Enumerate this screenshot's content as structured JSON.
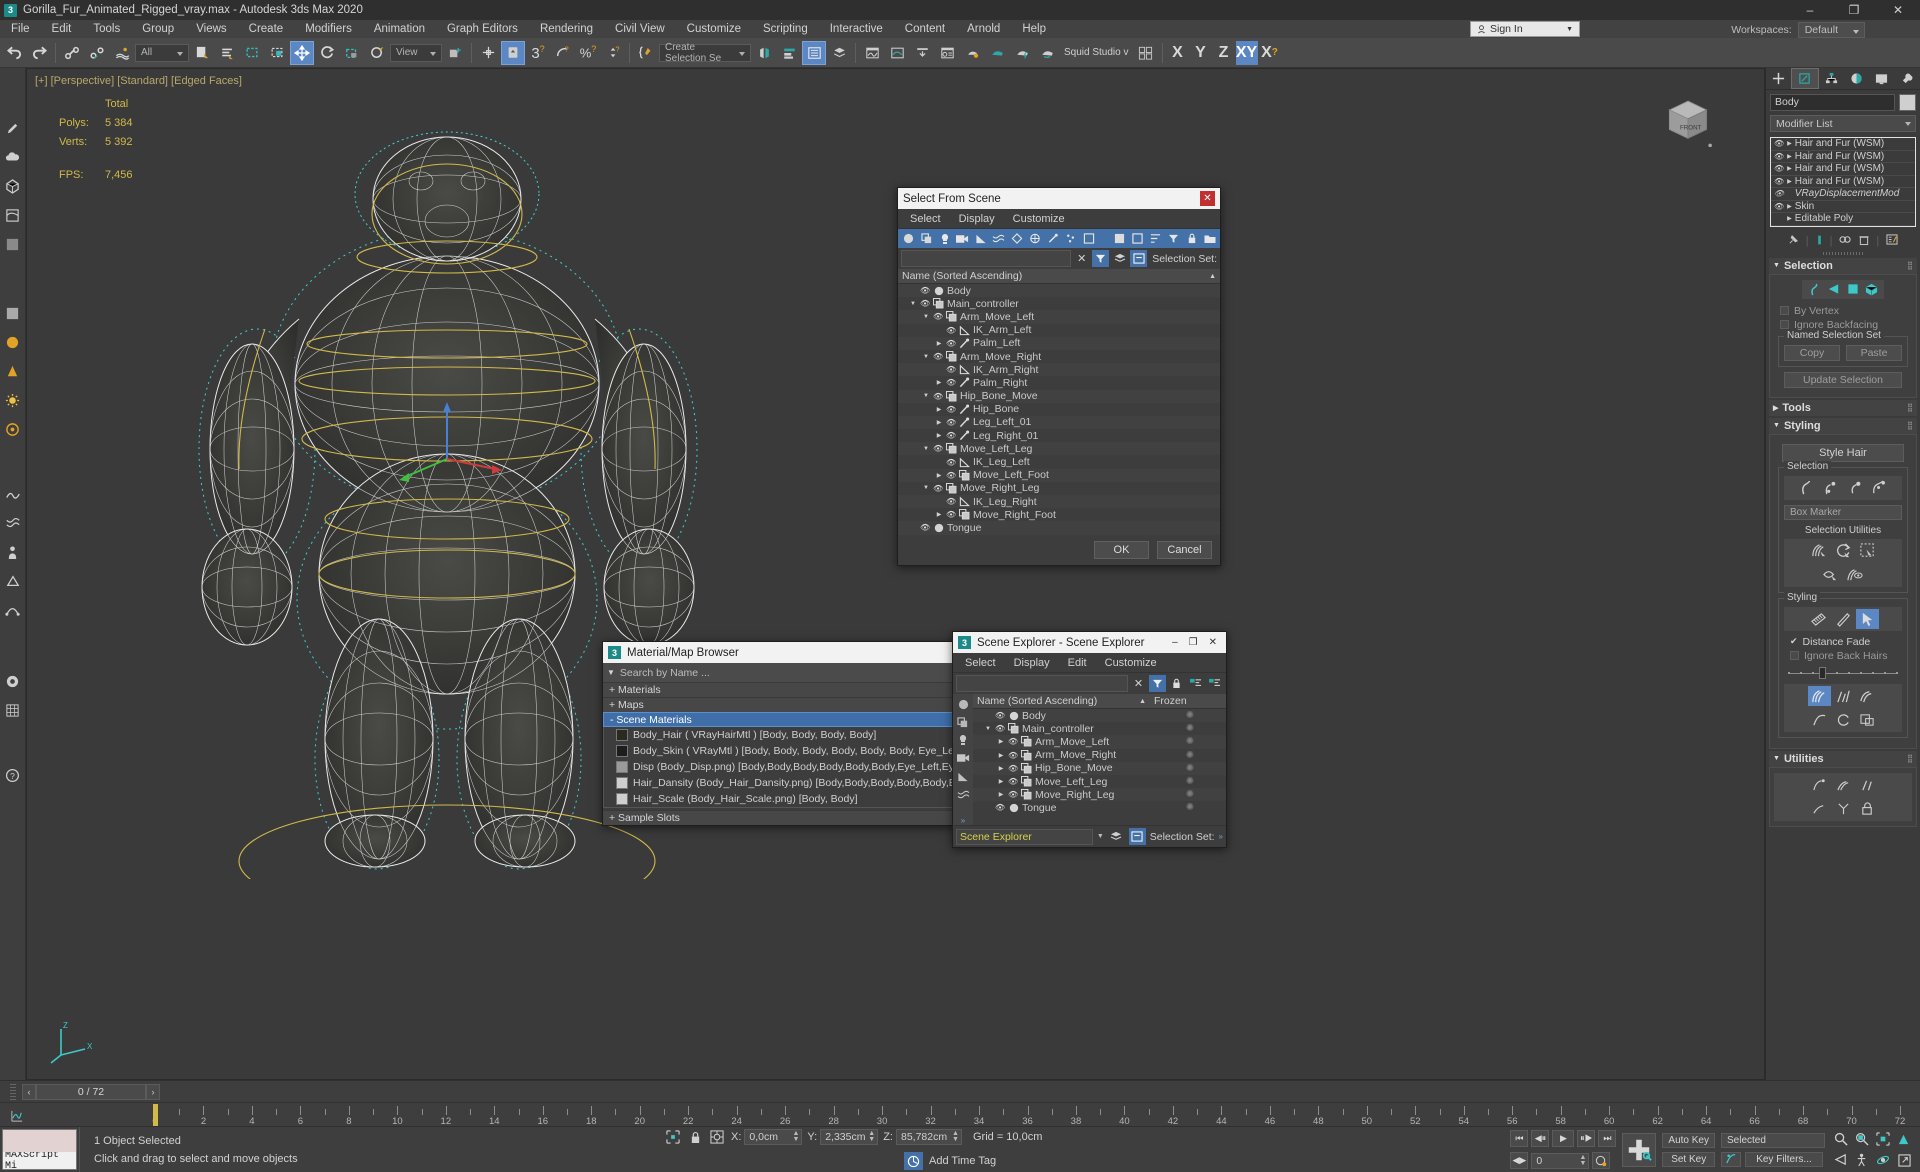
{
  "window": {
    "title": "Gorilla_Fur_Animated_Rigged_vray.max - Autodesk 3ds Max 2020",
    "app_icon": "3",
    "minimize": "–",
    "maximize": "❐",
    "close": "✕"
  },
  "menubar": {
    "items": [
      "File",
      "Edit",
      "Tools",
      "Group",
      "Views",
      "Create",
      "Modifiers",
      "Animation",
      "Graph Editors",
      "Rendering",
      "Civil View",
      "Customize",
      "Scripting",
      "Interactive",
      "Content",
      "Arnold",
      "Help"
    ],
    "signin_label": "Sign In",
    "workspaces_label": "Workspaces:",
    "workspace_value": "Default"
  },
  "toolbar": {
    "selection_filter": "All",
    "reference_coord": "View",
    "named_selection_set": "Create Selection Se",
    "render_preset": "Squid Studio v",
    "axis_x": "X",
    "axis_y": "Y",
    "axis_z": "Z",
    "axis_xy": "XY",
    "axis_xsup": "X"
  },
  "viewport": {
    "label": "[+] [Perspective] [Standard] [Edged Faces]",
    "stats_header": "Total",
    "polys_label": "Polys:",
    "polys_value": "5 384",
    "verts_label": "Verts:",
    "verts_value": "5 392",
    "fps_label": "FPS:",
    "fps_value": "7,456"
  },
  "command_panel": {
    "tabs": [
      "create-tab",
      "modify-tab",
      "hierarchy-tab",
      "motion-tab",
      "display-tab",
      "utilities-tab"
    ],
    "object_name": "Body",
    "modifier_list_label": "Modifier List",
    "modifier_stack": [
      {
        "name": "Hair and Fur (WSM)",
        "expandable": true,
        "italic": false
      },
      {
        "name": "Hair and Fur (WSM)",
        "expandable": true,
        "italic": false
      },
      {
        "name": "Hair and Fur (WSM)",
        "expandable": true,
        "italic": false
      },
      {
        "name": "Hair and Fur (WSM)",
        "expandable": true,
        "italic": false
      },
      {
        "name": "VRayDisplacementMod",
        "expandable": false,
        "italic": true
      },
      {
        "name": "Skin",
        "expandable": true,
        "italic": false
      },
      {
        "name": "Editable Poly",
        "expandable": true,
        "italic": false,
        "no_eye": true
      }
    ],
    "rollouts": {
      "selection": {
        "title": "Selection",
        "by_vertex": "By Vertex",
        "ignore_backfacing": "Ignore Backfacing",
        "named_selection_set_group": "Named Selection Set",
        "copy": "Copy",
        "paste": "Paste",
        "update_selection": "Update Selection"
      },
      "tools": {
        "title": "Tools"
      },
      "styling": {
        "title": "Styling",
        "style_hair": "Style Hair",
        "selection_group": "Selection",
        "box_marker": "Box Marker",
        "selection_utilities": "Selection Utilities",
        "styling_group": "Styling",
        "distance_fade": "Distance Fade",
        "ignore_back_hairs": "Ignore Back Hairs"
      },
      "utilities": {
        "title": "Utilities"
      }
    }
  },
  "select_from_scene": {
    "title": "Select From Scene",
    "close": "✕",
    "menu": [
      "Select",
      "Display",
      "Customize"
    ],
    "selection_set_label": "Selection Set:",
    "column_header": "Name (Sorted Ascending)",
    "tree": [
      {
        "name": "Body",
        "depth": 0,
        "icon": "sphere",
        "expander": "none"
      },
      {
        "name": "Main_controller",
        "depth": 0,
        "icon": "group",
        "expander": "open"
      },
      {
        "name": "Arm_Move_Left",
        "depth": 1,
        "icon": "group",
        "expander": "open"
      },
      {
        "name": "IK_Arm_Left",
        "depth": 2,
        "icon": "helper",
        "expander": "none"
      },
      {
        "name": "Palm_Left",
        "depth": 2,
        "icon": "bone",
        "expander": "closed"
      },
      {
        "name": "Arm_Move_Right",
        "depth": 1,
        "icon": "group",
        "expander": "open"
      },
      {
        "name": "IK_Arm_Right",
        "depth": 2,
        "icon": "helper",
        "expander": "none"
      },
      {
        "name": "Palm_Right",
        "depth": 2,
        "icon": "bone",
        "expander": "closed"
      },
      {
        "name": "Hip_Bone_Move",
        "depth": 1,
        "icon": "group",
        "expander": "open"
      },
      {
        "name": "Hip_Bone",
        "depth": 2,
        "icon": "bone",
        "expander": "closed"
      },
      {
        "name": "Leg_Left_01",
        "depth": 2,
        "icon": "bone",
        "expander": "closed"
      },
      {
        "name": "Leg_Right_01",
        "depth": 2,
        "icon": "bone",
        "expander": "closed"
      },
      {
        "name": "Move_Left_Leg",
        "depth": 1,
        "icon": "group",
        "expander": "open"
      },
      {
        "name": "IK_Leg_Left",
        "depth": 2,
        "icon": "helper",
        "expander": "none"
      },
      {
        "name": "Move_Left_Foot",
        "depth": 2,
        "icon": "group",
        "expander": "closed"
      },
      {
        "name": "Move_Right_Leg",
        "depth": 1,
        "icon": "group",
        "expander": "open"
      },
      {
        "name": "IK_Leg_Right",
        "depth": 2,
        "icon": "helper",
        "expander": "none"
      },
      {
        "name": "Move_Right_Foot",
        "depth": 2,
        "icon": "group",
        "expander": "closed"
      },
      {
        "name": "Tongue",
        "depth": 0,
        "icon": "sphere",
        "expander": "none"
      }
    ],
    "ok": "OK",
    "cancel": "Cancel"
  },
  "material_browser": {
    "title": "Material/Map Browser",
    "app_icon": "3",
    "close": "✕",
    "search_placeholder": "Search by Name ...",
    "categories": [
      {
        "label": "+ Materials",
        "selected": false
      },
      {
        "label": "+ Maps",
        "selected": false
      },
      {
        "label": "- Scene Materials",
        "selected": true
      }
    ],
    "scene_materials": [
      {
        "name": "Body_Hair  ( VRayHairMtl )  [Body, Body, Body, Body]",
        "swatch": "#2a2a20"
      },
      {
        "name": "Body_Skin   ( VRayMtl )  [Body, Body, Body, Body, Body, Body, Eye_Left, Ey...",
        "swatch": "#1d1d1d"
      },
      {
        "name": "Disp (Body_Disp.png) [Body,Body,Body,Body,Body,Body,Eye_Left,Eye_...",
        "swatch": "#9a9a9a"
      },
      {
        "name": "Hair_Dansity (Body_Hair_Dansity.png) [Body,Body,Body,Body,Body,Body]",
        "swatch": "#cfcfcf"
      },
      {
        "name": "Hair_Scale (Body_Hair_Scale.png)  [Body, Body]",
        "swatch": "#cfcfcf"
      }
    ],
    "sample_slots": "+ Sample Slots"
  },
  "scene_explorer": {
    "app_icon": "3",
    "title": "Scene Explorer - Scene Explorer",
    "minimize": "–",
    "maximize": "❐",
    "close": "✕",
    "menu": [
      "Select",
      "Display",
      "Edit",
      "Customize"
    ],
    "columns": {
      "name": "Name (Sorted Ascending)",
      "frozen": "Frozen"
    },
    "tree": [
      {
        "name": "Body",
        "depth": 0,
        "icon": "sphere",
        "expander": "none"
      },
      {
        "name": "Main_controller",
        "depth": 0,
        "icon": "group",
        "expander": "open"
      },
      {
        "name": "Arm_Move_Left",
        "depth": 1,
        "icon": "group",
        "expander": "closed"
      },
      {
        "name": "Arm_Move_Right",
        "depth": 1,
        "icon": "group",
        "expander": "closed"
      },
      {
        "name": "Hip_Bone_Move",
        "depth": 1,
        "icon": "group",
        "expander": "closed"
      },
      {
        "name": "Move_Left_Leg",
        "depth": 1,
        "icon": "group",
        "expander": "closed"
      },
      {
        "name": "Move_Right_Leg",
        "depth": 1,
        "icon": "group",
        "expander": "closed"
      },
      {
        "name": "Tongue",
        "depth": 0,
        "icon": "sphere",
        "expander": "none"
      }
    ],
    "footer_dropdown": "Scene Explorer",
    "selection_set_label": "Selection Set:"
  },
  "timeline": {
    "current_frame_display": "0 / 72",
    "prev": "‹",
    "next": "›",
    "start": 0,
    "end": 72,
    "tick_labels": [
      0,
      2,
      4,
      6,
      8,
      10,
      12,
      14,
      16,
      18,
      20,
      22,
      24,
      26,
      28,
      30,
      32,
      34,
      36,
      38,
      40,
      42,
      44,
      46,
      48,
      50,
      52,
      54,
      56,
      58,
      60,
      62,
      64,
      66,
      68,
      70,
      72
    ]
  },
  "statusbar": {
    "maxscript_label": "MAXScript Mi",
    "objects_selected": "1 Object Selected",
    "prompt": "Click and drag to select and move objects",
    "coord_x_label": "X:",
    "coord_x_value": "0,0cm",
    "coord_y_label": "Y:",
    "coord_y_value": "2,335cm",
    "coord_z_label": "Z:",
    "coord_z_value": "85,782cm",
    "grid_label": "Grid = 10,0cm",
    "add_time_tag": "Add Time Tag",
    "auto_key": "Auto Key",
    "set_key": "Set Key",
    "key_mode": "Selected",
    "key_filters": "Key Filters...",
    "frame_field": "0"
  }
}
